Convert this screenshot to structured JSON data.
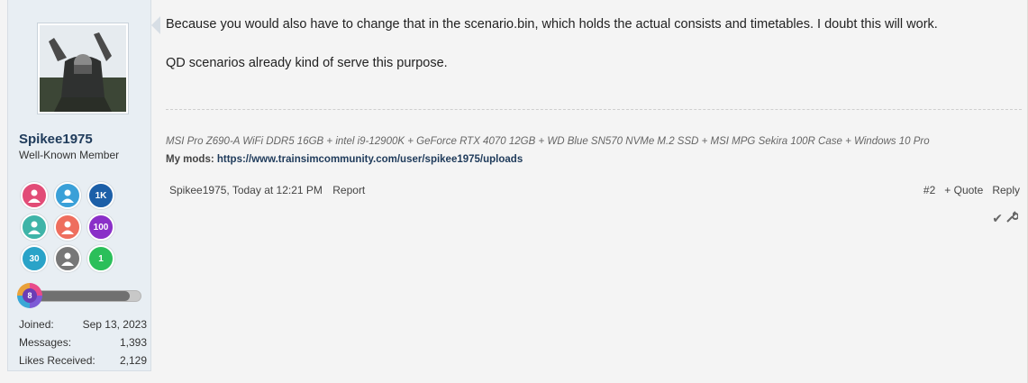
{
  "user": {
    "name": "Spikee1975",
    "title": "Well-Known Member",
    "trophies": [
      {
        "icon": "person-red-icon",
        "text": "",
        "color": "#e24c77"
      },
      {
        "icon": "person-blue-icon",
        "text": "",
        "color": "#3aa0d8"
      },
      {
        "icon": "likes-1k-badge",
        "text": "1K",
        "color": "#1c5fa8"
      },
      {
        "icon": "person-teal-icon",
        "text": "",
        "color": "#3fb4a8"
      },
      {
        "icon": "person-coral-icon",
        "text": "",
        "color": "#ee6e5e"
      },
      {
        "icon": "count-100-badge",
        "text": "100",
        "color": "#8a2fc8"
      },
      {
        "icon": "count-30-badge",
        "text": "30",
        "color": "#2aa3c8"
      },
      {
        "icon": "person-gray-icon",
        "text": "",
        "color": "#777777"
      },
      {
        "icon": "count-1-badge",
        "text": "1",
        "color": "#2bbf5a"
      }
    ],
    "level": "8",
    "xp_progress": 0.9,
    "stats": {
      "joined_label": "Joined:",
      "joined_value": "Sep 13, 2023",
      "messages_label": "Messages:",
      "messages_value": "1,393",
      "likes_label": "Likes Received:",
      "likes_value": "2,129"
    }
  },
  "post": {
    "paragraphs": [
      "Because you would also have to change that in the scenario.bin, which holds the actual consists and timetables. I doubt this will work.",
      "QD scenarios already kind of serve this purpose."
    ],
    "signature": {
      "specs": "MSI Pro Z690-A WiFi DDR5 16GB + intel i9-12900K + GeForce RTX 4070 12GB + WD Blue SN570 NVMe M.2 SSD + MSI MPG Sekira 100R Case + Windows 10 Pro",
      "mods_label": "My mods:",
      "mods_link": "https://www.trainsimcommunity.com/user/spikee1975/uploads"
    },
    "meta": {
      "byline": "Spikee1975, Today at 12:21 PM",
      "report": "Report"
    },
    "actions": {
      "number": "#2",
      "quote": "+ Quote",
      "reply": "Reply"
    },
    "mod_tools": {
      "approve_icon": "✔",
      "tools_icon": "🔧"
    }
  }
}
